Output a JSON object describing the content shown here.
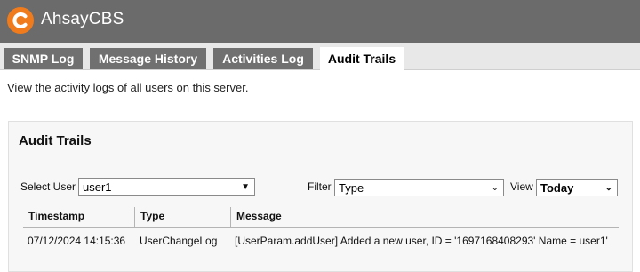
{
  "app": {
    "brand": "AhsayCBS",
    "logo_icon": "ahsay-logo-icon",
    "accent": "#f07b1c"
  },
  "tabs": [
    {
      "label": "SNMP Log",
      "active": false
    },
    {
      "label": "Message History",
      "active": false
    },
    {
      "label": "Activities Log",
      "active": false
    },
    {
      "label": "Audit Trails",
      "active": true
    }
  ],
  "page": {
    "description": "View the activity logs of all users on this server."
  },
  "panel": {
    "title": "Audit Trails",
    "select_user_label": "Select User",
    "select_user_value": "user1",
    "filter_label": "Filter",
    "filter_value": "Type",
    "view_label": "View",
    "view_value": "Today"
  },
  "table": {
    "columns": [
      "Timestamp",
      "Type",
      "Message"
    ],
    "rows": [
      {
        "timestamp": "07/12/2024 14:15:36",
        "type": "UserChangeLog",
        "message": "[UserParam.addUser] Added a new user, ID = '1697168408293' Name = user1'"
      }
    ]
  }
}
